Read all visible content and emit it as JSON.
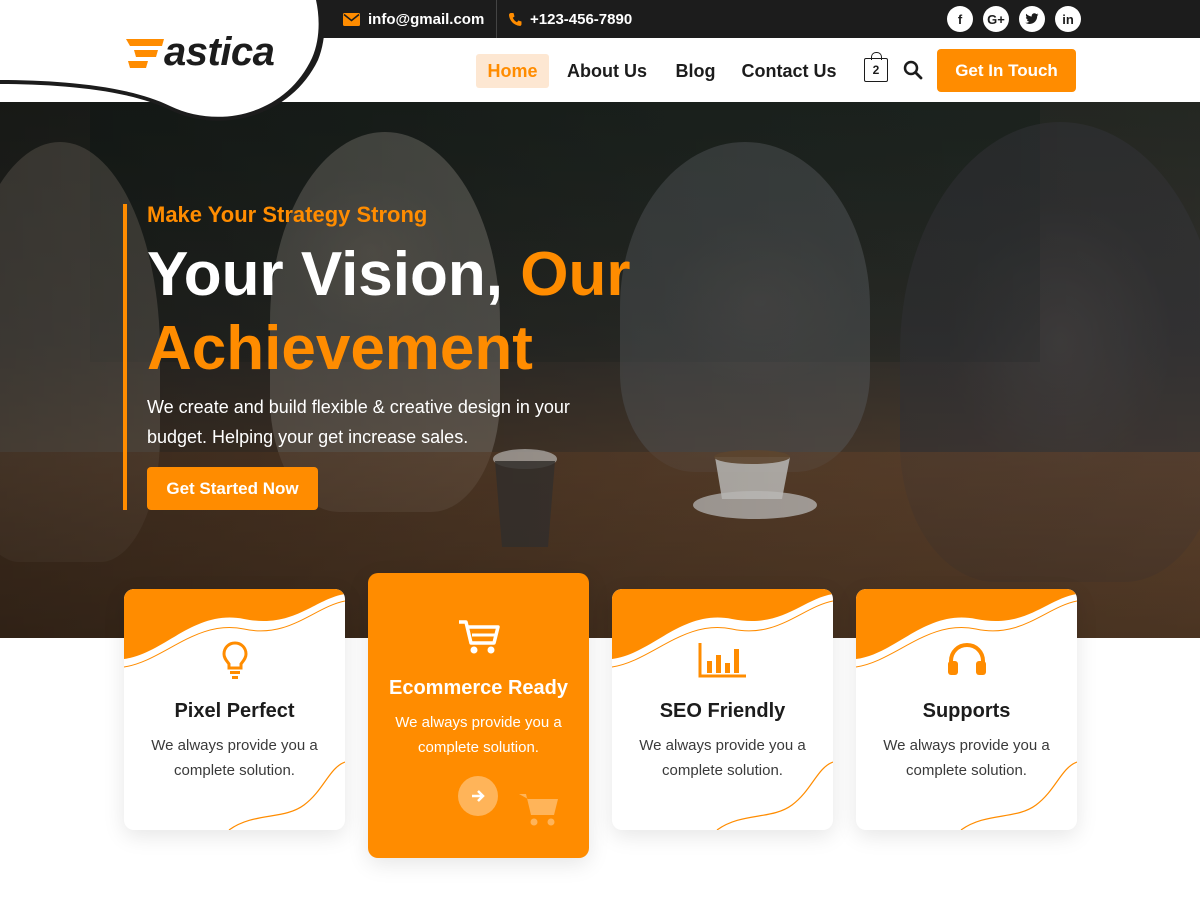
{
  "topbar": {
    "email": "info@gmail.com",
    "phone": "+123-456-7890",
    "socials": [
      {
        "icon": "facebook-icon",
        "glyph": "f"
      },
      {
        "icon": "google-plus-icon",
        "glyph": "G+"
      },
      {
        "icon": "twitter-icon",
        "glyph": "t"
      },
      {
        "icon": "linkedin-icon",
        "glyph": "in"
      }
    ]
  },
  "brand": {
    "logo_text": "astica",
    "accent": "#ff8c00",
    "dark": "#1c1c1c"
  },
  "nav": {
    "items": [
      {
        "label": "Home",
        "active": true
      },
      {
        "label": "About Us",
        "active": false
      },
      {
        "label": "Blog",
        "active": false
      },
      {
        "label": "Contact Us",
        "active": false
      }
    ],
    "cart_count": "2",
    "cta_label": "Get In Touch"
  },
  "hero": {
    "eyebrow": "Make Your Strategy Strong",
    "headline_white": "Your Vision,",
    "headline_orange_1": "Our",
    "headline_orange_2": "Achievement",
    "text": "We create and build flexible & creative design in your budget. Helping your get increase sales.",
    "button_label": "Get Started Now"
  },
  "features": [
    {
      "title": "Pixel Perfect",
      "desc": "We always provide you a complete solution.",
      "icon": "lightbulb-icon",
      "featured": false
    },
    {
      "title": "Ecommerce Ready",
      "desc": "We always provide you a complete solution.",
      "icon": "cart-icon",
      "featured": true
    },
    {
      "title": "SEO Friendly",
      "desc": "We always provide you a complete solution.",
      "icon": "bar-chart-icon",
      "featured": false
    },
    {
      "title": "Supports",
      "desc": "We always provide you a complete solution.",
      "icon": "headphones-icon",
      "featured": false
    }
  ]
}
